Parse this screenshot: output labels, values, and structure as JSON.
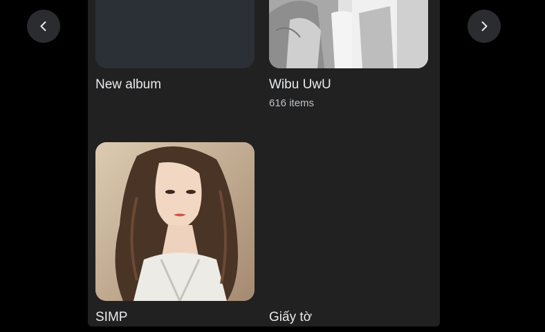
{
  "nav": {
    "prev_icon": "chevron-left-icon",
    "next_icon": "chevron-right-icon"
  },
  "albums": [
    {
      "title": "New album",
      "count": ""
    },
    {
      "title": "Wibu UwU",
      "count": "616 items"
    },
    {
      "title": "SIMP",
      "count": ""
    },
    {
      "title": "Giấy tờ",
      "count": ""
    }
  ],
  "colors": {
    "background": "#000000",
    "panel": "#212121",
    "nav_button": "#2b2c2f",
    "title_text": "#e8eaed",
    "subtitle_text": "#bdc1c6",
    "empty_cover": "#2b2f36"
  }
}
